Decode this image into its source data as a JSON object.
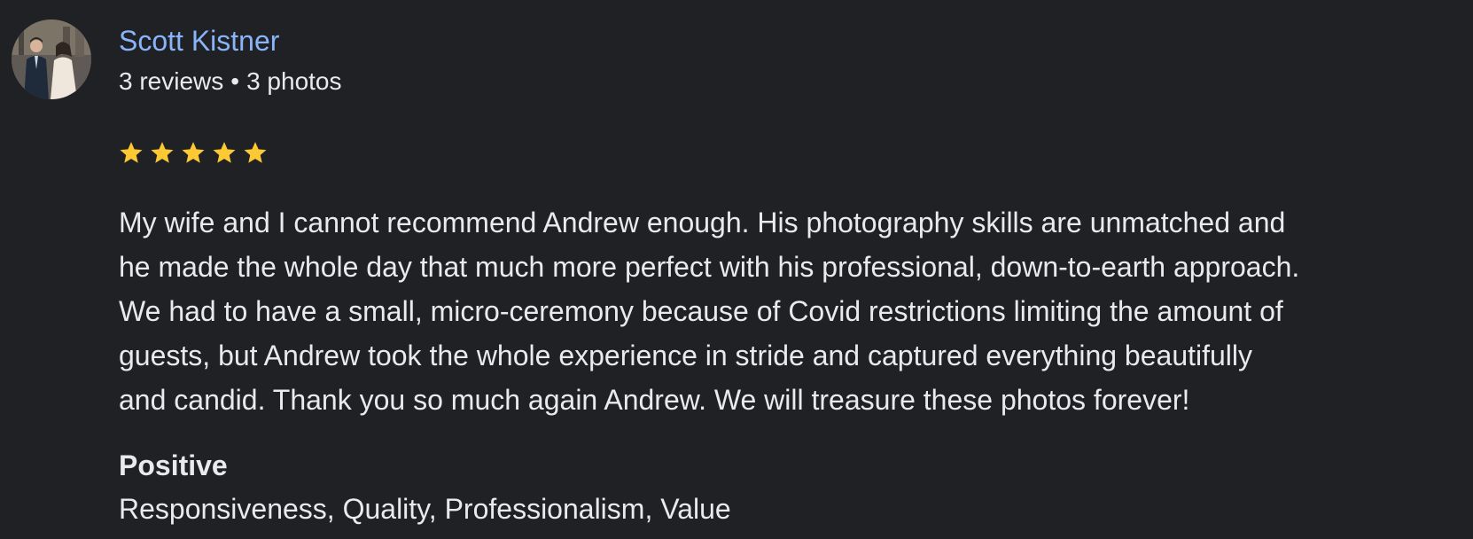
{
  "reviewer": {
    "name": "Scott Kistner",
    "review_count": "3 reviews",
    "separator": "•",
    "photo_count": "3 photos",
    "avatar_icon": "profile-photo-couple"
  },
  "rating": {
    "stars": 5,
    "max_stars": 5,
    "star_color": "#fcc934",
    "icon": "star-icon"
  },
  "review": {
    "lines": [
      "My wife and I cannot recommend Andrew enough. His photography skills are unmatched and",
      "he made the whole day that much more perfect with his professional, down-to-earth approach.",
      "We had to have a small, micro-ceremony because of Covid restrictions limiting the amount of",
      "guests, but Andrew took the whole experience in stride and captured everything beautifully",
      "and candid. Thank you so much again Andrew. We will treasure these photos forever!"
    ]
  },
  "attributes": {
    "heading": "Positive",
    "values": "Responsiveness, Quality, Professionalism, Value"
  },
  "colors": {
    "background": "#202124",
    "name_link": "#8ab4f8",
    "text": "#e8eaed"
  }
}
